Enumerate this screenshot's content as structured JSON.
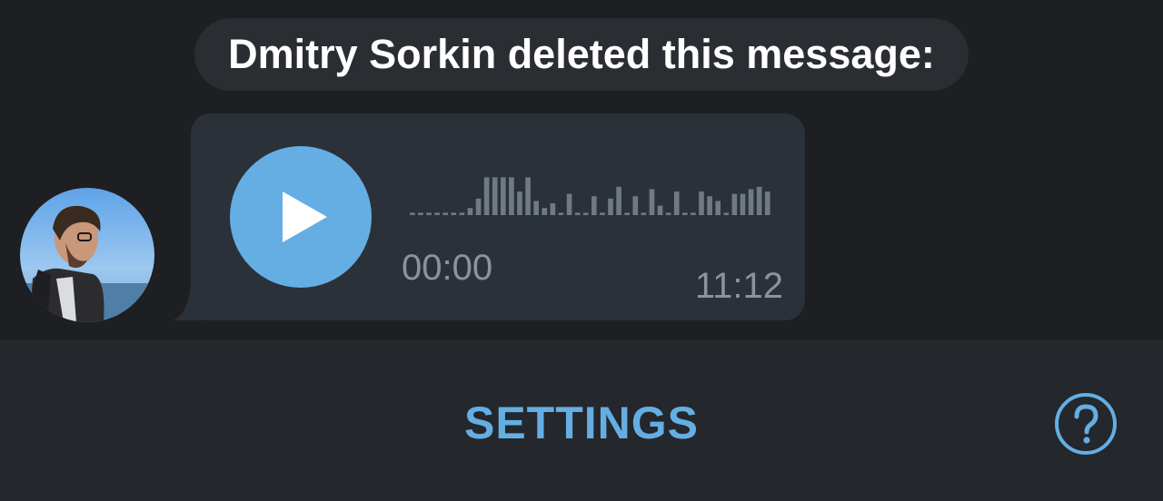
{
  "chat": {
    "service_message": "Dmitry Sorkin deleted this message:",
    "voice_message": {
      "elapsed": "00:00",
      "time": "11:12",
      "waveform": [
        0.05,
        0.05,
        0.05,
        0.05,
        0.05,
        0.05,
        0.05,
        0.15,
        0.35,
        0.8,
        0.8,
        0.8,
        0.8,
        0.5,
        0.8,
        0.3,
        0.15,
        0.25,
        0.05,
        0.45,
        0.05,
        0.05,
        0.4,
        0.05,
        0.35,
        0.6,
        0.05,
        0.4,
        0.05,
        0.55,
        0.2,
        0.05,
        0.5,
        0.05,
        0.05,
        0.5,
        0.4,
        0.3,
        0.05,
        0.45,
        0.45,
        0.55,
        0.6,
        0.5
      ]
    }
  },
  "bottom_bar": {
    "settings_label": "SETTINGS",
    "help_icon": "question-circle-icon"
  },
  "colors": {
    "accent": "#64aee3",
    "background": "#1d1f22",
    "bubble": "#2b3138",
    "waveform": "#6f7a85",
    "muted_text": "#8b939b"
  }
}
